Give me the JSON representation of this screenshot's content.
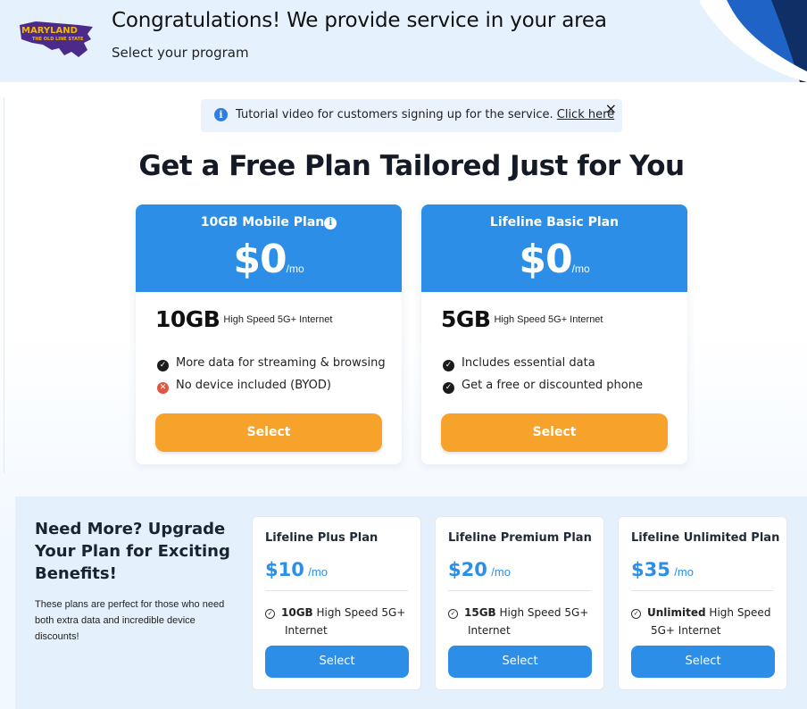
{
  "header": {
    "logo": {
      "line1": "MARYLAND",
      "line2": "THE OLD LINE STATE"
    },
    "title": "Congratulations! We provide service in your area",
    "subtitle": "Select your program"
  },
  "tutorial": {
    "text": "Tutorial video for customers signing up for the service.",
    "link": "Click here",
    "close": "×"
  },
  "headline": "Get a Free Plan Tailored Just for You",
  "plans": [
    {
      "name": "10GB Mobile Plan",
      "price": "$0",
      "period": "/mo",
      "data": "10GB",
      "data_desc": "High Speed 5G+ Internet",
      "features": [
        {
          "text": "More data for streaming & browsing",
          "icon": "check-icon"
        },
        {
          "text": "No device included (BYOD)",
          "icon": "cross-icon"
        }
      ],
      "select": "Select"
    },
    {
      "name": "Lifeline Basic Plan",
      "price": "$0",
      "period": "/mo",
      "data": "5GB",
      "data_desc": "High Speed 5G+ Internet",
      "features": [
        {
          "text": "Includes essential data",
          "icon": "check-icon"
        },
        {
          "text": "Get a free or discounted phone",
          "icon": "check-icon"
        }
      ],
      "select": "Select"
    }
  ],
  "upgrade": {
    "title": "Need More? Upgrade Your Plan for Exciting Benefits!",
    "desc": "These plans are perfect for those who need both extra data and incredible device discounts!",
    "plans": [
      {
        "name": "Lifeline Plus Plan",
        "price": "$10",
        "period": "/mo",
        "bold": "10GB",
        "rest1": " High Speed 5G+",
        "rest2": "Internet",
        "select": "Select"
      },
      {
        "name": "Lifeline Premium Plan",
        "price": "$20",
        "period": "/mo",
        "bold": "15GB",
        "rest1": " High Speed 5G+",
        "rest2": "Internet",
        "select": "Select"
      },
      {
        "name": "Lifeline Unlimited Plan",
        "price": "$35",
        "period": "/mo",
        "bold": "Unlimited",
        "rest1": " High Speed",
        "rest2": "5G+ Internet",
        "select": "Select"
      }
    ]
  },
  "colors": {
    "blue": "#2d8ee8",
    "orange": "#f6a22b",
    "header_bg": "#e5f2fd"
  }
}
